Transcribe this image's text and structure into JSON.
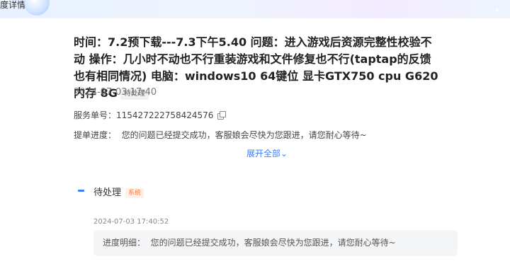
{
  "header": {
    "title": "度详情"
  },
  "ticket": {
    "title": "时间：7.2预下载---7.3下午5.40 问题：进入游戏后资源完整性校验不动 操作：几小时不动也不行重装游戏和文件修复也不行(taptap的反馈也有相同情况) 电脑：windows10 64键位 显卡GTX750 cpu G620 内存 8G",
    "status": "待处理",
    "date": "2024-07-03 17:40",
    "service_label": "服务单号：",
    "service_number": "115427222758424576",
    "progress_label": "提单进度：",
    "progress_text": "您的问题已经提交成功，客服娘会尽快为您跟进，请您耐心等待~",
    "expand_label": "展开全部"
  },
  "timeline": {
    "items": [
      {
        "status": "待处理",
        "tag": "系统",
        "time": "2024-07-03 17:40:52",
        "detail_label": "进度明细：",
        "detail_text": "您的问题已经提交成功，客服娘会尽快为您跟进，请您耐心等待~"
      }
    ]
  },
  "colors": {
    "accent": "#3a7cff",
    "system_tag": "#ff7a3d"
  }
}
